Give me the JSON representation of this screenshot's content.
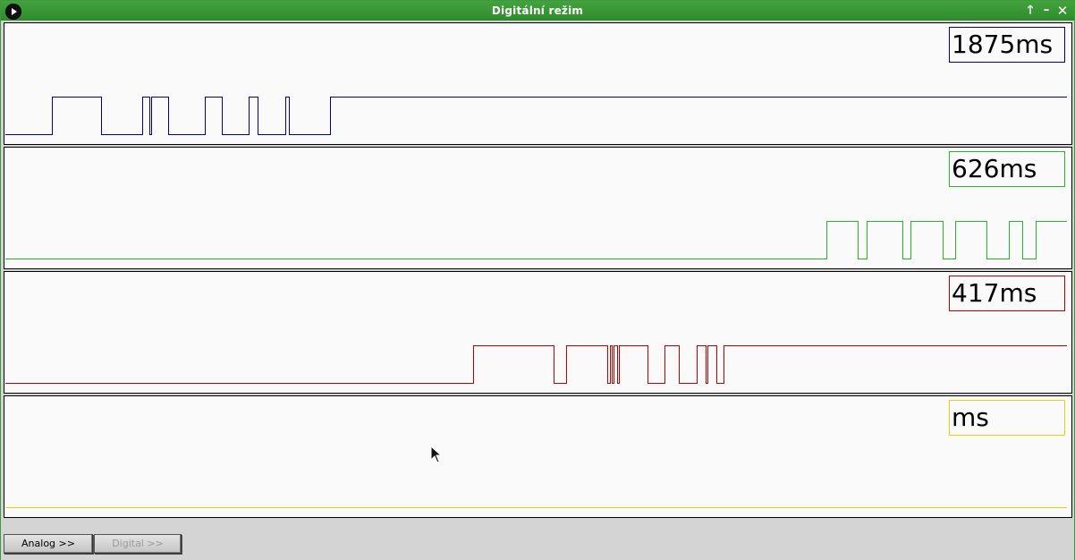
{
  "window": {
    "title": "Digitální režim",
    "icons": {
      "app": "play-icon",
      "up": "arrow-up-icon",
      "minimize": "minimize-icon",
      "close": "close-icon"
    },
    "glyphs": {
      "up": "🡑",
      "minimize": "–",
      "close": "✕"
    }
  },
  "channels": [
    {
      "label": "1875ms",
      "color": "#00008b",
      "baseline_frac": 0.9,
      "high_frac": 0.5,
      "transitions": [
        53,
        108,
        154,
        162,
        164,
        183,
        224,
        243,
        273,
        283,
        314,
        318,
        364
      ]
    },
    {
      "label": "626ms",
      "color": "#22bb22",
      "baseline_frac": 0.9,
      "high_frac": 0.5,
      "transitions": [
        919,
        954,
        964,
        1004,
        1013,
        1049,
        1063,
        1098,
        1123,
        1138,
        1153
      ]
    },
    {
      "label": "417ms",
      "color": "#bb0000",
      "baseline_frac": 0.9,
      "high_frac": 0.5,
      "transitions": [
        524,
        614,
        628,
        674,
        677,
        679,
        681,
        685,
        687,
        719,
        738,
        754,
        774,
        784,
        786,
        796,
        804
      ]
    },
    {
      "label": "ms",
      "color": "#e6d200",
      "baseline_frac": 0.9,
      "high_frac": 0.5,
      "transitions": []
    }
  ],
  "buttons": {
    "analog": "Analog >>",
    "digital": "Digital >>"
  }
}
